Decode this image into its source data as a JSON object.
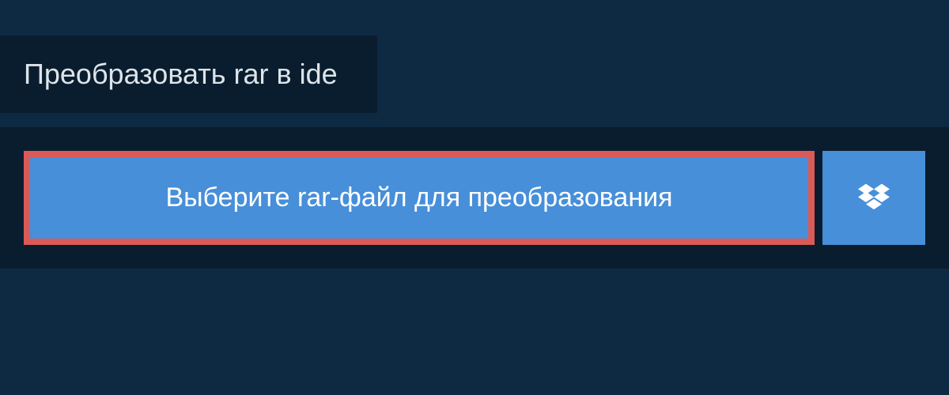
{
  "header": {
    "title": "Преобразовать rar в ide"
  },
  "upload": {
    "file_button_label": "Выберите rar-файл для преобразования",
    "dropbox_icon_name": "dropbox-icon"
  },
  "colors": {
    "page_bg": "#0e2a42",
    "panel_bg": "#0a1d2e",
    "button_bg": "#478fd9",
    "highlight_border": "#db5a57",
    "text_light": "#dce4ea",
    "text_white": "#ffffff"
  }
}
